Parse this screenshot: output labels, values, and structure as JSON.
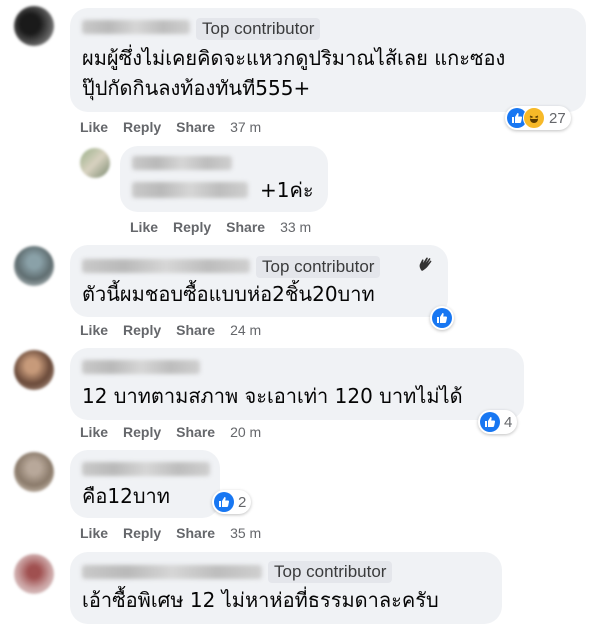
{
  "colors": {
    "bubble": "#f0f2f5",
    "like_blue": "#1877f2",
    "haha_yellow": "#f7b928",
    "meta_gray": "#65676b"
  },
  "actions": {
    "like": "Like",
    "reply": "Reply",
    "share": "Share"
  },
  "comments": [
    {
      "badge": "Top contributor",
      "text1": "ผมผู้ซึ่งไม่เคยคิดจะแหวกดูปริมาณไส้เลย แกะซอง",
      "text2": "ปุ๊ปกัดกินลงท้องทันที555+",
      "time": "37 m",
      "reactions": [
        "like-icon",
        "haha-icon"
      ],
      "count": "27"
    },
    {
      "text": "+1ค่ะ",
      "time": "33 m"
    },
    {
      "badge": "Top contributor",
      "badge_icon": "wave-icon",
      "text": "ตัวนี้ผมชอบซื้อแบบห่อ2ชิ้น20บาท",
      "time": "24 m",
      "reactions": [
        "like-icon"
      ]
    },
    {
      "text": "12 บาทตามสภาพ จะเอาเท่า 120 บาทไม่ได้",
      "time": "20 m",
      "reactions": [
        "like-icon"
      ],
      "count": "4"
    },
    {
      "text": "คือ12บาท",
      "time": "35 m",
      "reactions": [
        "like-icon"
      ],
      "count": "2"
    },
    {
      "badge": "Top contributor",
      "text": "เอ้าซื้อพิเศษ 12 ไม่หาห่อที่ธรรมดาละครับ"
    }
  ]
}
